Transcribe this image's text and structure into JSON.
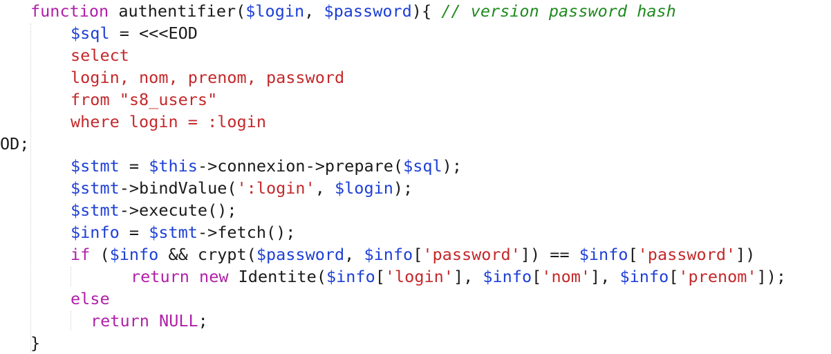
{
  "editor": {
    "language": "php",
    "colors": {
      "keyword": "#b01fa8",
      "variable": "#1d3fd6",
      "string": "#c4282a",
      "comment": "#1f8a1f",
      "plain": "#1a1a1a",
      "background": "#ffffff"
    },
    "lines": [
      {
        "indent": 1,
        "tokens": [
          {
            "t": "function",
            "k": "kw"
          },
          {
            "t": " authentifier(",
            "k": "pl"
          },
          {
            "t": "$login",
            "k": "var"
          },
          {
            "t": ", ",
            "k": "pl"
          },
          {
            "t": "$password",
            "k": "var"
          },
          {
            "t": "){ ",
            "k": "pl"
          },
          {
            "t": "// version password hash",
            "k": "cm"
          }
        ]
      },
      {
        "indent": 2,
        "tokens": [
          {
            "t": "$sql",
            "k": "var"
          },
          {
            "t": " = <<<EOD",
            "k": "pl"
          }
        ]
      },
      {
        "indent": 2,
        "tokens": [
          {
            "t": "select",
            "k": "sql"
          }
        ]
      },
      {
        "indent": 2,
        "tokens": [
          {
            "t": "login, nom, prenom, password",
            "k": "sql"
          }
        ]
      },
      {
        "indent": 2,
        "tokens": [
          {
            "t": "from \"s8_users\"",
            "k": "sql"
          }
        ]
      },
      {
        "indent": 2,
        "tokens": [
          {
            "t": "where login = :login",
            "k": "sql"
          }
        ]
      },
      {
        "indent": 0,
        "tokens": [
          {
            "t": "OD;",
            "k": "pl"
          }
        ]
      },
      {
        "indent": 2,
        "tokens": [
          {
            "t": "$stmt",
            "k": "var"
          },
          {
            "t": " = ",
            "k": "pl"
          },
          {
            "t": "$this",
            "k": "var"
          },
          {
            "t": "->connexion->prepare(",
            "k": "pl"
          },
          {
            "t": "$sql",
            "k": "var"
          },
          {
            "t": ");",
            "k": "pl"
          }
        ]
      },
      {
        "indent": 2,
        "tokens": [
          {
            "t": "$stmt",
            "k": "var"
          },
          {
            "t": "->bindValue(",
            "k": "pl"
          },
          {
            "t": "':login'",
            "k": "str"
          },
          {
            "t": ", ",
            "k": "pl"
          },
          {
            "t": "$login",
            "k": "var"
          },
          {
            "t": ");",
            "k": "pl"
          }
        ]
      },
      {
        "indent": 2,
        "tokens": [
          {
            "t": "$stmt",
            "k": "var"
          },
          {
            "t": "->execute();",
            "k": "pl"
          }
        ]
      },
      {
        "indent": 2,
        "tokens": [
          {
            "t": "$info",
            "k": "var"
          },
          {
            "t": " = ",
            "k": "pl"
          },
          {
            "t": "$stmt",
            "k": "var"
          },
          {
            "t": "->fetch();",
            "k": "pl"
          }
        ]
      },
      {
        "indent": 2,
        "tokens": [
          {
            "t": "if",
            "k": "kw"
          },
          {
            "t": " (",
            "k": "pl"
          },
          {
            "t": "$info",
            "k": "var"
          },
          {
            "t": " && crypt(",
            "k": "pl"
          },
          {
            "t": "$password",
            "k": "var"
          },
          {
            "t": ", ",
            "k": "pl"
          },
          {
            "t": "$info",
            "k": "var"
          },
          {
            "t": "[",
            "k": "pl"
          },
          {
            "t": "'password'",
            "k": "str"
          },
          {
            "t": "]) == ",
            "k": "pl"
          },
          {
            "t": "$info",
            "k": "var"
          },
          {
            "t": "[",
            "k": "pl"
          },
          {
            "t": "'password'",
            "k": "str"
          },
          {
            "t": "])",
            "k": "pl"
          }
        ]
      },
      {
        "indent": 3,
        "tokens": [
          {
            "t": "return",
            "k": "kw"
          },
          {
            "t": " ",
            "k": "pl"
          },
          {
            "t": "new",
            "k": "kw"
          },
          {
            "t": " Identite(",
            "k": "pl"
          },
          {
            "t": "$info",
            "k": "var"
          },
          {
            "t": "[",
            "k": "pl"
          },
          {
            "t": "'login'",
            "k": "str"
          },
          {
            "t": "], ",
            "k": "pl"
          },
          {
            "t": "$info",
            "k": "var"
          },
          {
            "t": "[",
            "k": "pl"
          },
          {
            "t": "'nom'",
            "k": "str"
          },
          {
            "t": "], ",
            "k": "pl"
          },
          {
            "t": "$info",
            "k": "var"
          },
          {
            "t": "[",
            "k": "pl"
          },
          {
            "t": "'prenom'",
            "k": "str"
          },
          {
            "t": "]);",
            "k": "pl"
          }
        ]
      },
      {
        "indent": 2,
        "tokens": [
          {
            "t": "else",
            "k": "kw"
          }
        ]
      },
      {
        "indent": 2.5,
        "tokens": [
          {
            "t": "return",
            "k": "kw"
          },
          {
            "t": " ",
            "k": "pl"
          },
          {
            "t": "NULL",
            "k": "kw"
          },
          {
            "t": ";",
            "k": "pl"
          }
        ]
      },
      {
        "indent": 1,
        "tokens": [
          {
            "t": "}",
            "k": "pl"
          }
        ]
      }
    ]
  }
}
